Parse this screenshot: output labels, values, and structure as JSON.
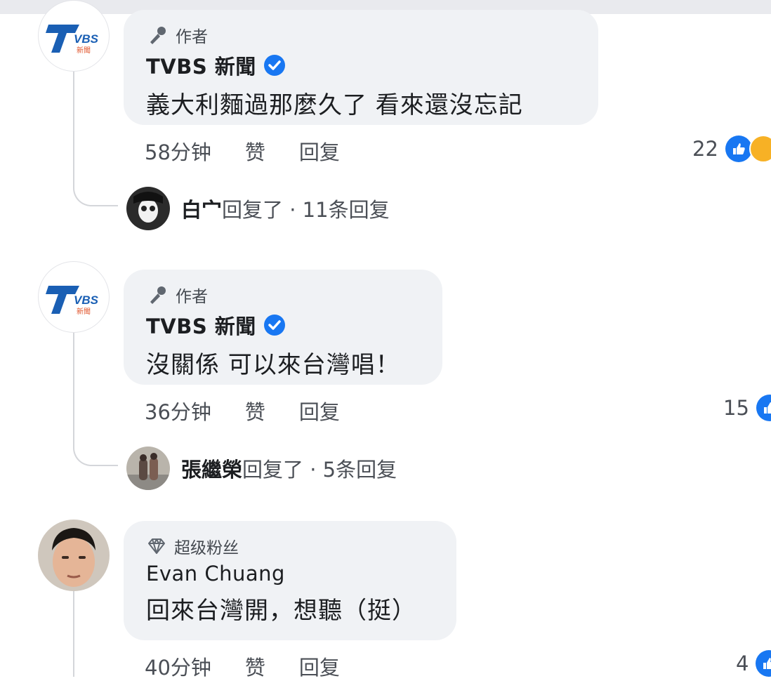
{
  "comments": [
    {
      "badge": "作者",
      "author": "TVBS 新聞",
      "text": "義大利麵過那麼久了 看來還沒忘記",
      "time": "58分钟",
      "like_label": "赞",
      "reply_label": "回复",
      "reaction_count": "22",
      "replies": {
        "name": "白宀",
        "suffix": "回复了",
        "count": "· 11条回复"
      }
    },
    {
      "badge": "作者",
      "author": "TVBS 新聞",
      "text": "沒關係 可以來台灣唱！",
      "time": "36分钟",
      "like_label": "赞",
      "reply_label": "回复",
      "reaction_count": "15",
      "replies": {
        "name": "張繼榮",
        "suffix": "回复了",
        "count": "· 5条回复"
      }
    },
    {
      "badge": "超级粉丝",
      "author": "Evan Chuang",
      "text": "回來台灣開，想聽（挺）",
      "time": "40分钟",
      "like_label": "赞",
      "reply_label": "回复",
      "reaction_count": "4"
    }
  ],
  "logo": {
    "letters": "VBS",
    "sub": "新聞",
    "brand_color": "#1a5fb4",
    "accent_color": "#e0532a"
  },
  "icons": [
    "microphone-icon",
    "verified-badge-icon",
    "diamond-icon",
    "like-icon",
    "haha-icon"
  ]
}
